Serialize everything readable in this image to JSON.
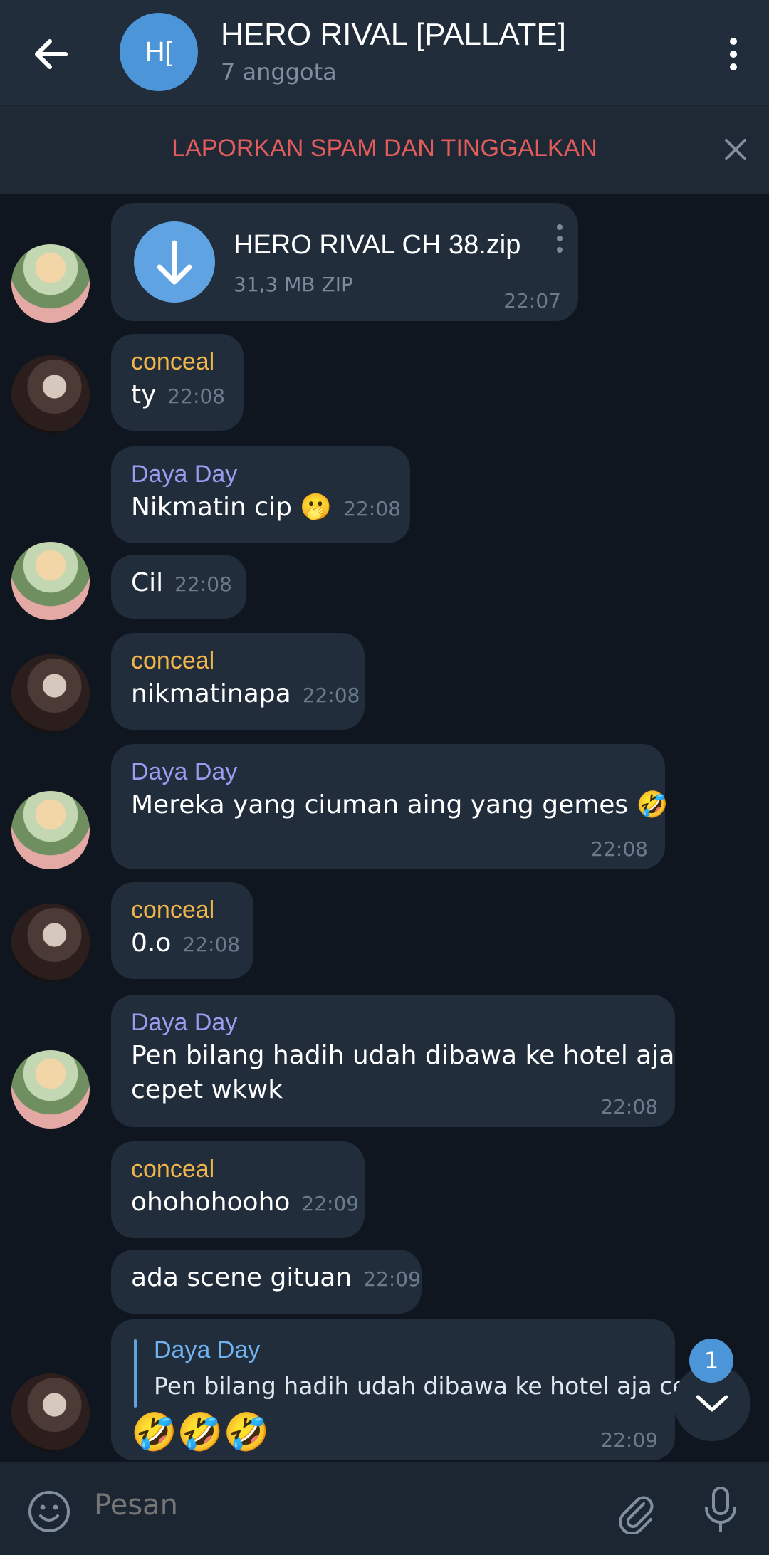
{
  "header": {
    "avatar_initials": "H[",
    "title": "HERO RIVAL [PALLATE]",
    "subtitle": "7 anggota"
  },
  "spam_banner": {
    "text": "LAPORKAN SPAM DAN TINGGALKAN"
  },
  "messages": [
    {
      "type": "file",
      "file_name": "HERO RIVAL CH 38.zip",
      "file_size": "31,3 MB ZIP",
      "time": "22:07"
    },
    {
      "sender": "conceal",
      "text": "ty",
      "time": "22:08"
    },
    {
      "sender": "Daya Day",
      "text": "Nikmatin cip 🫢",
      "time": "22:08"
    },
    {
      "text": "Cil",
      "time": "22:08"
    },
    {
      "sender": "conceal",
      "text": "nikmatinapa",
      "time": "22:08"
    },
    {
      "sender": "Daya Day",
      "text": "Mereka yang ciuman aing yang gemes 🤣",
      "time": "22:08"
    },
    {
      "sender": "conceal",
      "text": "0.o",
      "time": "22:08"
    },
    {
      "sender": "Daya Day",
      "text_line1": "Pen bilang hadih udah dibawa ke hotel aja",
      "text_line2": "cepet wkwk",
      "time": "22:08"
    },
    {
      "sender": "conceal",
      "text": "ohohohooho",
      "time": "22:09"
    },
    {
      "text": "ada scene gituan",
      "time": "22:09"
    },
    {
      "type": "reply",
      "reply_to": "Daya Day",
      "reply_text": "Pen bilang hadih udah dibawa ke hotel aja ce...",
      "text": "🤣🤣🤣",
      "time": "22:09"
    }
  ],
  "unread_badge": "1",
  "composer": {
    "placeholder": "Pesan"
  },
  "colors": {
    "accent": "#4d95d9",
    "spam_red": "#e35c5c",
    "name_orange": "#f0b54a",
    "name_purple": "#9a9cf0",
    "bubble": "#212d3b",
    "background": "#0e1621"
  },
  "icons": [
    "back-arrow-icon",
    "more-vertical-icon",
    "close-icon",
    "download-icon",
    "chevron-down-icon",
    "emoji-icon",
    "paperclip-icon",
    "microphone-icon"
  ]
}
